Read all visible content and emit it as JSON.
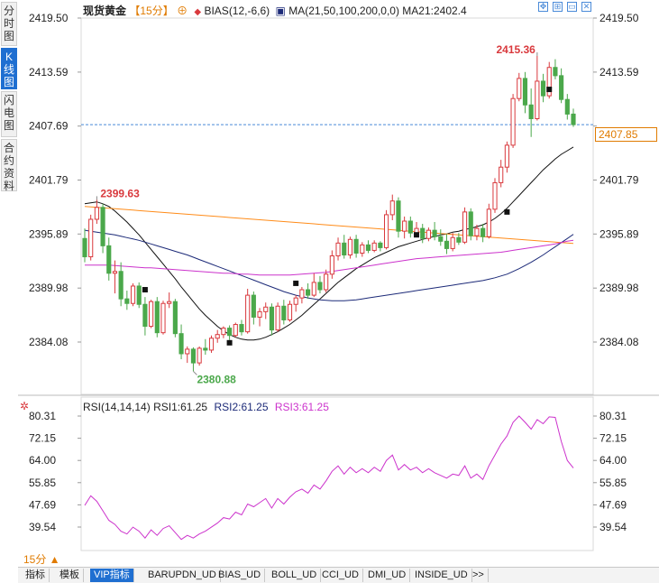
{
  "sidebar": [
    {
      "label": "分时图",
      "active": false
    },
    {
      "label": "K线图",
      "active": true
    },
    {
      "label": "闪电图",
      "active": false
    },
    {
      "label": "合约资料",
      "active": false
    }
  ],
  "header": {
    "symbol": "现货黄金",
    "period": "【15分】",
    "bias": "BIAS(12,-6,6)",
    "ma": "MA(21,50,100,200,0,0)",
    "ma21": "MA21:2402.4"
  },
  "rsi_header": {
    "label": "RSI(14,14,14)",
    "rsi1": "RSI1:61.25",
    "rsi2": "RSI2:61.25",
    "rsi3": "RSI3:61.25"
  },
  "price_tag": "2407.85",
  "period_selector": "15分 ▲",
  "bottom_tabs": [
    {
      "label": "指标",
      "active": false
    },
    {
      "label": "模板",
      "active": false
    },
    {
      "label": "VIP指标",
      "active": true
    },
    {
      "label": "BARUPDN_UD",
      "active": false
    },
    {
      "label": "BIAS_UD",
      "active": false
    },
    {
      "label": "BOLL_UD",
      "active": false
    },
    {
      "label": "CCI_UD",
      "active": false
    },
    {
      "label": "DMI_UD",
      "active": false
    },
    {
      "label": "INSIDE_UD",
      "active": false
    },
    {
      "label": ">>",
      "active": false
    }
  ],
  "colors": {
    "up": "#d9393d",
    "down": "#4ba84b",
    "ma21": "#111111",
    "ma50": "#ff8c1a",
    "ma100": "#1c2a78",
    "ma200": "#cc33cc",
    "rsi": "#cc33cc",
    "grid_accent": "#4a8ad8"
  },
  "chart_data": [
    {
      "type": "candlestick",
      "ylim": [
        2380.0,
        2420.5
      ],
      "yticks": [
        "2419.50",
        "2413.59",
        "2407.69",
        "2401.79",
        "2395.89",
        "2389.98",
        "2384.08"
      ],
      "current_price": 2407.85,
      "annotations": [
        {
          "label": "2399.63",
          "index": 2,
          "price": 2399.63
        },
        {
          "label": "2380.88",
          "index": 18,
          "price": 2380.88
        },
        {
          "label": "2415.36",
          "index": 75,
          "price": 2415.36
        }
      ],
      "ohlc": [
        [
          2395.4,
          2396.5,
          2392.8,
          2393.4
        ],
        [
          2393.4,
          2398.0,
          2393.0,
          2397.5
        ],
        [
          2397.5,
          2399.63,
          2397.0,
          2398.8
        ],
        [
          2398.8,
          2399.2,
          2393.8,
          2394.6
        ],
        [
          2394.6,
          2395.5,
          2390.8,
          2391.6
        ],
        [
          2391.6,
          2393.0,
          2389.4,
          2391.8
        ],
        [
          2391.8,
          2392.8,
          2388.0,
          2388.8
        ],
        [
          2388.8,
          2389.7,
          2387.6,
          2388.3
        ],
        [
          2388.3,
          2390.5,
          2388.0,
          2390.2
        ],
        [
          2390.2,
          2390.6,
          2387.8,
          2388.2
        ],
        [
          2388.2,
          2389.0,
          2384.8,
          2385.8
        ],
        [
          2385.8,
          2388.7,
          2385.6,
          2388.5
        ],
        [
          2388.5,
          2389.0,
          2384.6,
          2385.1
        ],
        [
          2385.1,
          2388.6,
          2384.9,
          2388.3
        ],
        [
          2388.3,
          2389.5,
          2387.8,
          2388.5
        ],
        [
          2388.5,
          2388.8,
          2384.6,
          2385.0
        ],
        [
          2385.0,
          2386.0,
          2382.2,
          2382.8
        ],
        [
          2382.8,
          2383.6,
          2381.8,
          2383.3
        ],
        [
          2383.3,
          2383.5,
          2380.88,
          2381.8
        ],
        [
          2381.8,
          2383.6,
          2381.5,
          2383.4
        ],
        [
          2383.4,
          2384.4,
          2382.7,
          2383.2
        ],
        [
          2383.2,
          2384.8,
          2382.9,
          2384.5
        ],
        [
          2384.5,
          2385.4,
          2384.0,
          2384.9
        ],
        [
          2384.9,
          2385.8,
          2384.5,
          2385.6
        ],
        [
          2385.6,
          2385.9,
          2384.3,
          2384.8
        ],
        [
          2384.8,
          2386.2,
          2384.6,
          2386.0
        ],
        [
          2386.0,
          2386.5,
          2384.8,
          2385.2
        ],
        [
          2385.2,
          2389.9,
          2385.0,
          2389.2
        ],
        [
          2389.2,
          2389.6,
          2386.0,
          2386.8
        ],
        [
          2386.8,
          2387.8,
          2385.8,
          2387.4
        ],
        [
          2387.4,
          2388.4,
          2386.6,
          2387.9
        ],
        [
          2387.9,
          2388.3,
          2384.8,
          2385.4
        ],
        [
          2385.4,
          2388.4,
          2385.2,
          2388.0
        ],
        [
          2388.0,
          2388.7,
          2386.0,
          2386.5
        ],
        [
          2386.5,
          2388.6,
          2386.3,
          2388.2
        ],
        [
          2388.2,
          2389.2,
          2387.4,
          2388.9
        ],
        [
          2388.9,
          2390.1,
          2388.3,
          2389.8
        ],
        [
          2389.8,
          2390.5,
          2388.8,
          2389.2
        ],
        [
          2389.2,
          2391.6,
          2389.0,
          2390.6
        ],
        [
          2390.6,
          2391.3,
          2389.4,
          2389.8
        ],
        [
          2389.8,
          2392.0,
          2389.5,
          2391.5
        ],
        [
          2391.5,
          2394.1,
          2391.0,
          2393.5
        ],
        [
          2393.5,
          2395.5,
          2393.0,
          2394.9
        ],
        [
          2394.9,
          2395.8,
          2393.2,
          2393.6
        ],
        [
          2393.6,
          2395.6,
          2393.2,
          2395.3
        ],
        [
          2395.3,
          2395.8,
          2393.3,
          2393.8
        ],
        [
          2393.8,
          2395.0,
          2393.4,
          2394.7
        ],
        [
          2394.7,
          2395.2,
          2393.8,
          2394.1
        ],
        [
          2394.1,
          2395.2,
          2393.9,
          2394.9
        ],
        [
          2394.9,
          2395.1,
          2394.0,
          2394.4
        ],
        [
          2394.4,
          2398.5,
          2394.2,
          2398.0
        ],
        [
          2398.0,
          2400.2,
          2397.4,
          2399.5
        ],
        [
          2399.5,
          2399.9,
          2395.5,
          2396.2
        ],
        [
          2396.2,
          2397.8,
          2395.4,
          2397.3
        ],
        [
          2397.3,
          2397.8,
          2395.5,
          2396.0
        ],
        [
          2396.0,
          2397.2,
          2395.6,
          2396.5
        ],
        [
          2396.5,
          2397.0,
          2394.9,
          2395.4
        ],
        [
          2395.4,
          2396.6,
          2395.1,
          2396.3
        ],
        [
          2396.3,
          2397.2,
          2395.2,
          2395.6
        ],
        [
          2395.6,
          2396.4,
          2394.6,
          2395.1
        ],
        [
          2395.1,
          2395.9,
          2393.7,
          2394.3
        ],
        [
          2394.3,
          2396.0,
          2394.0,
          2395.5
        ],
        [
          2395.5,
          2396.0,
          2394.7,
          2395.0
        ],
        [
          2395.0,
          2398.8,
          2394.8,
          2398.3
        ],
        [
          2398.3,
          2398.7,
          2395.2,
          2395.7
        ],
        [
          2395.7,
          2396.9,
          2395.2,
          2396.5
        ],
        [
          2396.5,
          2397.0,
          2395.0,
          2395.6
        ],
        [
          2395.6,
          2399.2,
          2395.4,
          2398.6
        ],
        [
          2398.6,
          2402.0,
          2398.2,
          2401.5
        ],
        [
          2401.5,
          2404.0,
          2401.0,
          2403.2
        ],
        [
          2403.2,
          2406.0,
          2402.6,
          2405.6
        ],
        [
          2405.6,
          2411.2,
          2405.3,
          2410.7
        ],
        [
          2410.7,
          2413.5,
          2410.4,
          2412.9
        ],
        [
          2412.9,
          2413.6,
          2409.1,
          2410.0
        ],
        [
          2410.0,
          2411.8,
          2406.5,
          2408.5
        ],
        [
          2408.5,
          2415.36,
          2408.3,
          2412.6
        ],
        [
          2412.6,
          2413.4,
          2410.3,
          2411.0
        ],
        [
          2411.0,
          2414.7,
          2410.7,
          2414.1
        ],
        [
          2414.1,
          2415.0,
          2412.8,
          2413.2
        ],
        [
          2413.2,
          2414.0,
          2410.2,
          2410.6
        ],
        [
          2410.6,
          2411.2,
          2408.4,
          2409.0
        ],
        [
          2409.0,
          2409.6,
          2407.6,
          2407.85
        ]
      ],
      "ma_values": {
        "MA21": [
          2399.2,
          2399.3,
          2399.4,
          2399.2,
          2398.9,
          2398.4,
          2397.8,
          2397.2,
          2396.5,
          2395.8,
          2395.0,
          2394.2,
          2393.4,
          2392.6,
          2391.8,
          2391.0,
          2390.1,
          2389.3,
          2388.5,
          2387.7,
          2387.0,
          2386.4,
          2385.8,
          2385.3,
          2384.9,
          2384.6,
          2384.4,
          2384.3,
          2384.3,
          2384.4,
          2384.6,
          2384.9,
          2385.2,
          2385.6,
          2386.0,
          2386.5,
          2387.0,
          2387.6,
          2388.2,
          2388.8,
          2389.4,
          2390.0,
          2390.6,
          2391.1,
          2391.6,
          2392.1,
          2392.5,
          2392.9,
          2393.3,
          2393.6,
          2393.9,
          2394.2,
          2394.5,
          2394.7,
          2394.9,
          2395.1,
          2395.3,
          2395.5,
          2395.6,
          2395.8,
          2395.9,
          2396.1,
          2396.2,
          2396.4,
          2396.5,
          2396.7,
          2396.9,
          2397.2,
          2397.6,
          2398.1,
          2398.7,
          2399.4,
          2400.1,
          2400.8,
          2401.5,
          2402.2,
          2402.9,
          2403.5,
          2404.1,
          2404.6,
          2405.0,
          2405.4
        ],
        "MA50": [
          2398.9,
          2398.85,
          2398.8,
          2398.75,
          2398.7,
          2398.65,
          2398.6,
          2398.55,
          2398.5,
          2398.45,
          2398.4,
          2398.35,
          2398.3,
          2398.25,
          2398.2,
          2398.15,
          2398.1,
          2398.05,
          2398.0,
          2397.95,
          2397.9,
          2397.85,
          2397.8,
          2397.75,
          2397.7,
          2397.65,
          2397.6,
          2397.55,
          2397.5,
          2397.45,
          2397.4,
          2397.35,
          2397.3,
          2397.25,
          2397.2,
          2397.15,
          2397.1,
          2397.05,
          2397.0,
          2396.95,
          2396.9,
          2396.85,
          2396.8,
          2396.75,
          2396.7,
          2396.65,
          2396.6,
          2396.55,
          2396.5,
          2396.45,
          2396.4,
          2396.35,
          2396.3,
          2396.25,
          2396.2,
          2396.15,
          2396.1,
          2396.05,
          2396.0,
          2395.95,
          2395.9,
          2395.85,
          2395.8,
          2395.75,
          2395.7,
          2395.65,
          2395.6,
          2395.55,
          2395.5,
          2395.45,
          2395.4,
          2395.35,
          2395.3,
          2395.25,
          2395.2,
          2395.15,
          2395.1,
          2395.05,
          2395.0,
          2394.95,
          2394.9,
          2394.85
        ],
        "MA100": [
          2396.3,
          2396.2,
          2396.1,
          2396.0,
          2395.9,
          2395.8,
          2395.65,
          2395.5,
          2395.35,
          2395.2,
          2395.0,
          2394.8,
          2394.6,
          2394.4,
          2394.2,
          2394.0,
          2393.8,
          2393.6,
          2393.35,
          2393.1,
          2392.85,
          2392.6,
          2392.35,
          2392.1,
          2391.85,
          2391.6,
          2391.35,
          2391.1,
          2390.85,
          2390.6,
          2390.35,
          2390.1,
          2389.85,
          2389.6,
          2389.4,
          2389.2,
          2389.05,
          2388.9,
          2388.8,
          2388.7,
          2388.65,
          2388.6,
          2388.6,
          2388.6,
          2388.65,
          2388.7,
          2388.8,
          2388.9,
          2389.0,
          2389.1,
          2389.2,
          2389.3,
          2389.4,
          2389.5,
          2389.6,
          2389.7,
          2389.8,
          2389.9,
          2390.0,
          2390.1,
          2390.2,
          2390.3,
          2390.4,
          2390.5,
          2390.6,
          2390.7,
          2390.8,
          2390.95,
          2391.1,
          2391.3,
          2391.5,
          2391.8,
          2392.1,
          2392.45,
          2392.8,
          2393.2,
          2393.6,
          2394.05,
          2394.5,
          2394.95,
          2395.4,
          2395.85
        ],
        "MA200": [
          2392.5,
          2392.5,
          2392.5,
          2392.5,
          2392.5,
          2392.45,
          2392.4,
          2392.35,
          2392.3,
          2392.25,
          2392.2,
          2392.2,
          2392.15,
          2392.1,
          2392.05,
          2392.0,
          2391.95,
          2391.9,
          2391.85,
          2391.8,
          2391.75,
          2391.7,
          2391.65,
          2391.6,
          2391.6,
          2391.55,
          2391.5,
          2391.5,
          2391.45,
          2391.4,
          2391.4,
          2391.4,
          2391.4,
          2391.4,
          2391.4,
          2391.45,
          2391.5,
          2391.55,
          2391.6,
          2391.65,
          2391.7,
          2391.8,
          2391.9,
          2392.0,
          2392.1,
          2392.2,
          2392.3,
          2392.4,
          2392.5,
          2392.6,
          2392.7,
          2392.8,
          2392.9,
          2393.0,
          2393.1,
          2393.2,
          2393.25,
          2393.3,
          2393.35,
          2393.4,
          2393.45,
          2393.5,
          2393.55,
          2393.6,
          2393.65,
          2393.7,
          2393.75,
          2393.8,
          2393.85,
          2393.9,
          2394.0,
          2394.1,
          2394.2,
          2394.3,
          2394.4,
          2394.5,
          2394.6,
          2394.7,
          2394.8,
          2394.95,
          2395.1,
          2395.2
        ]
      }
    },
    {
      "type": "line",
      "name": "RSI",
      "ylim": [
        33,
        83
      ],
      "yticks": [
        "80.31",
        "72.15",
        "64.00",
        "55.85",
        "47.69",
        "39.54"
      ],
      "values": [
        47.5,
        51.0,
        49.0,
        45.5,
        42.0,
        40.5,
        38.0,
        37.0,
        39.5,
        38.0,
        35.5,
        38.5,
        36.5,
        39.0,
        40.0,
        37.5,
        35.0,
        36.5,
        35.5,
        37.0,
        38.0,
        39.5,
        41.0,
        43.0,
        42.5,
        45.0,
        44.0,
        48.0,
        47.0,
        48.5,
        50.0,
        46.5,
        50.0,
        48.0,
        50.5,
        52.5,
        53.5,
        52.0,
        55.0,
        53.5,
        56.5,
        60.0,
        62.0,
        59.0,
        61.5,
        59.5,
        61.0,
        59.5,
        61.5,
        60.0,
        64.0,
        66.0,
        60.5,
        62.5,
        60.5,
        61.5,
        59.5,
        61.0,
        59.5,
        58.5,
        57.5,
        59.0,
        58.5,
        62.0,
        57.5,
        59.0,
        57.0,
        62.0,
        66.0,
        70.0,
        73.0,
        78.0,
        80.3,
        78.0,
        75.5,
        79.0,
        77.5,
        80.0,
        79.8,
        71.0,
        64.0,
        61.25
      ]
    }
  ]
}
